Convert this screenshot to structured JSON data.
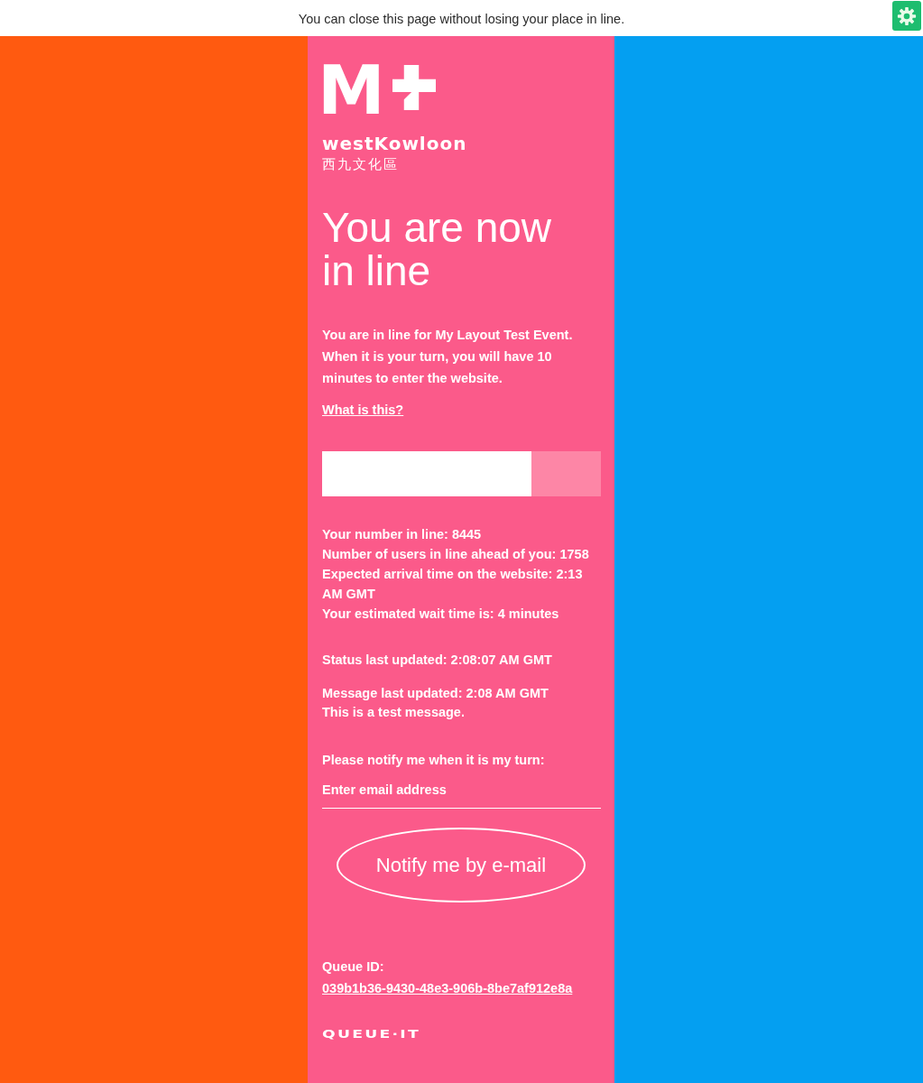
{
  "notice_bar": {
    "text": "You can close this page without losing your place in line."
  },
  "logo": {
    "mark": "M",
    "wordmark": "westKowloon",
    "chinese_name": "西九文化區"
  },
  "heading": "You are now in line",
  "intro": "You are in line for My Layout Test Event. When it is your turn, you will have 10 minutes to enter the website.",
  "help_link": "What is this?",
  "progress": {
    "level": 0.75
  },
  "stats": [
    "Your number in line: 8445",
    "Number of users in line ahead of you: 1758",
    "Expected arrival time on the website: 2:13 AM GMT",
    "Your estimated wait time is: 4 minutes"
  ],
  "status_updated": "Status last updated: 2:08:07 AM GMT",
  "message": {
    "updated": "Message last updated: 2:08 AM GMT",
    "text": "This is a test message."
  },
  "notify": {
    "label": "Please notify me when it is my turn:",
    "email_placeholder": "Enter email address",
    "button": "Notify me by e-mail"
  },
  "queue_id": {
    "label": "Queue ID:",
    "value": "039b1b36-9430-48e3-906b-8be7af912e8a"
  },
  "footer_logo": "QUEUE·IT"
}
